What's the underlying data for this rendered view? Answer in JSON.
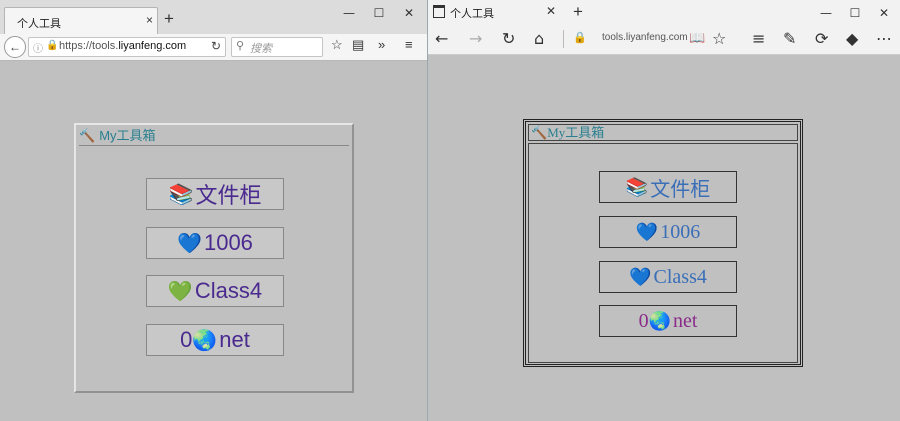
{
  "firefox": {
    "tab_title": "个人工具",
    "tab_close": "×",
    "new_tab": "+",
    "window_controls": {
      "minimize": "—",
      "maximize": "☐",
      "close": "✕"
    },
    "back_icon": "←",
    "url_prefix": "https://tools.",
    "url_domain": "liyanfeng.com",
    "reload_icon": "↻",
    "search_placeholder": "搜索",
    "toolbar_icons": [
      "☆",
      "▤",
      "»",
      "≡"
    ],
    "panel": {
      "title": "My工具箱",
      "title_icon": "hammer-icon",
      "buttons": [
        {
          "icon": "books-icon",
          "glyph": "📚",
          "label": "文件柜"
        },
        {
          "icon": "heart-icon",
          "glyph": "💙",
          "label": "1006"
        },
        {
          "icon": "heart-icon",
          "glyph": "💚",
          "label": "Class4"
        },
        {
          "icon": "globe-icon",
          "glyph": "🌏",
          "label": "net",
          "prefix": "0"
        }
      ]
    }
  },
  "edge": {
    "tab_title": "个人工具",
    "tab_close": "✕",
    "new_tab": "+",
    "window_controls": {
      "minimize": "—",
      "maximize": "☐",
      "close": "✕"
    },
    "nav_icons": {
      "back": "←",
      "forward": "→",
      "refresh": "↻",
      "home": "⌂"
    },
    "address": "tools.liyanfeng.com",
    "toolbar_icons": [
      "📖",
      "☆",
      "≡",
      "✎",
      "⟳",
      "◆",
      "⋯"
    ],
    "panel": {
      "title": "My工具箱",
      "title_icon": "hammer-icon",
      "buttons": [
        {
          "icon": "books-icon",
          "glyph": "📚",
          "label": "文件柜"
        },
        {
          "icon": "heart-icon",
          "glyph": "💙",
          "label": "1006"
        },
        {
          "icon": "heart-icon",
          "glyph": "💙",
          "label": "Class4"
        },
        {
          "icon": "globe-icon",
          "glyph": "🌏",
          "label": "net",
          "prefix": "0"
        }
      ]
    }
  },
  "colors": {
    "page_bg": "#c0c0c0",
    "title_teal": "#2a7f8f",
    "ff_button_text": "#4a2a8f",
    "edge_button_text": "#3a6fb8",
    "edge_purple": "#8a2a8a"
  }
}
